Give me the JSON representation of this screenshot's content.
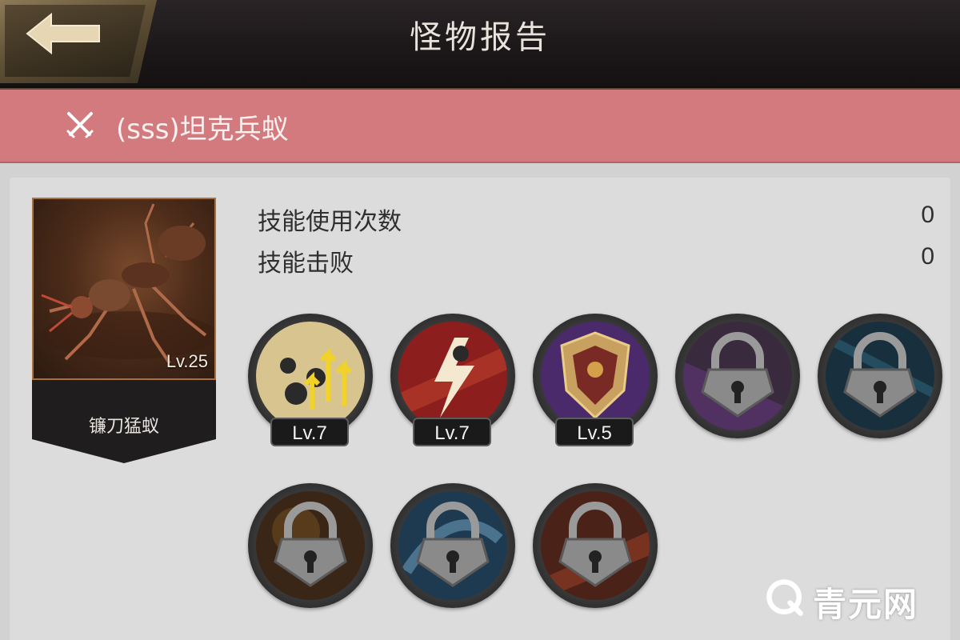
{
  "header": {
    "title": "怪物报告",
    "back_icon": "back-arrow-icon"
  },
  "banner": {
    "icon": "crossed-swords-icon",
    "monster_name": "(sss)坦克兵蚁"
  },
  "unit": {
    "name": "镰刀猛蚁",
    "level": "Lv.25"
  },
  "stats": [
    {
      "label": "技能使用次数",
      "value": "0"
    },
    {
      "label": "技能击败",
      "value": "0"
    }
  ],
  "skills": [
    {
      "icon": "ant-swarm-buff-icon",
      "level": "Lv.7",
      "locked": false
    },
    {
      "icon": "lightning-strike-icon",
      "level": "Lv.7",
      "locked": false
    },
    {
      "icon": "shield-guard-icon",
      "level": "Lv.5",
      "locked": false
    },
    {
      "icon": "lock-icon",
      "locked": true
    },
    {
      "icon": "lock-icon",
      "locked": true
    },
    {
      "icon": "lock-icon",
      "locked": true
    },
    {
      "icon": "lock-icon",
      "locked": true
    },
    {
      "icon": "lock-icon",
      "locked": true
    }
  ],
  "watermark": {
    "text": "青元网"
  },
  "colors": {
    "banner": "#d27a7d",
    "panel": "#dcdcdc",
    "header": "#1c1819",
    "back_button": "#5f5035"
  }
}
